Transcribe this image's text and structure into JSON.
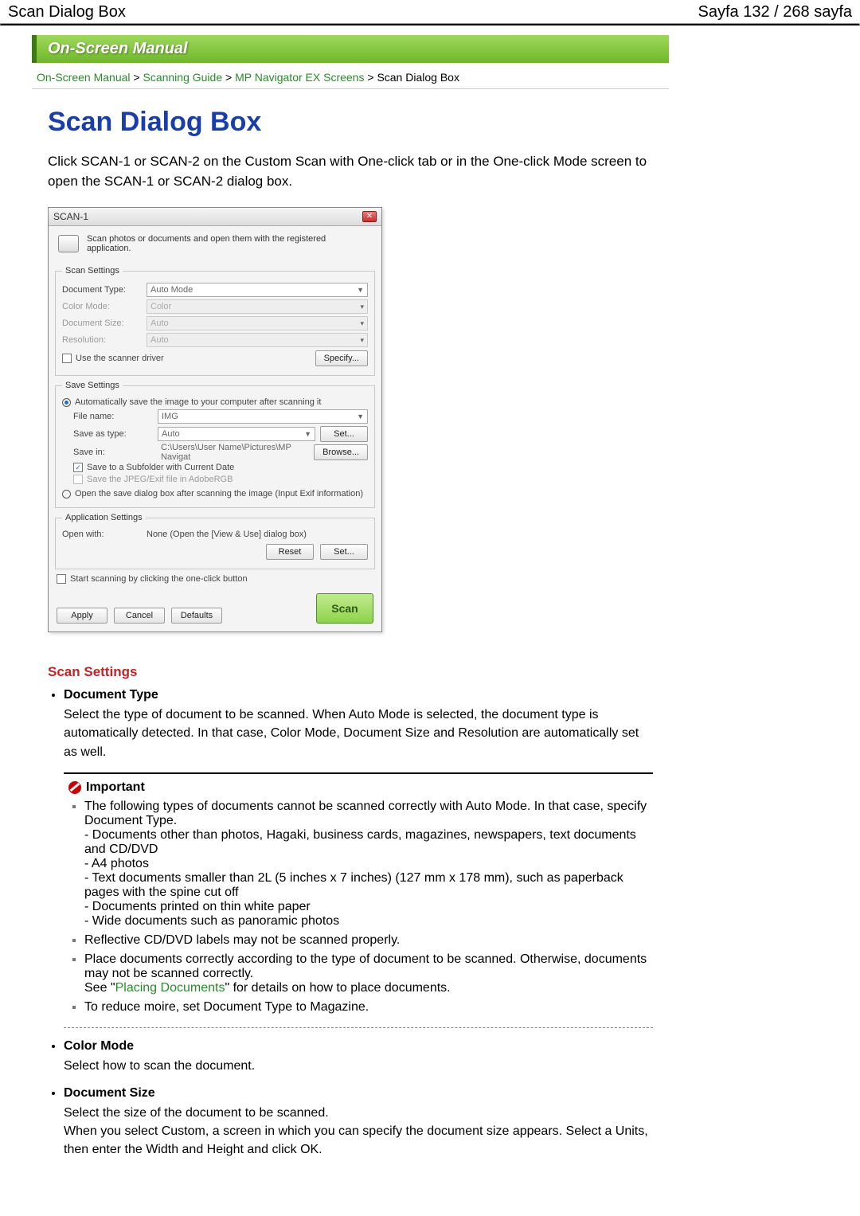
{
  "topbar": {
    "left": "Scan Dialog Box",
    "right": "Sayfa 132 / 268 sayfa"
  },
  "banner": "On-Screen Manual",
  "breadcrumb": {
    "items": [
      "On-Screen Manual",
      "Scanning Guide",
      "MP Navigator EX Screens"
    ],
    "current": "Scan Dialog Box"
  },
  "title": "Scan Dialog Box",
  "intro": "Click SCAN-1 or SCAN-2 on the Custom Scan with One-click tab or in the One-click Mode screen to open the SCAN-1 or SCAN-2 dialog box.",
  "dialog": {
    "title": "SCAN-1",
    "subtitle": "Scan photos or documents and open them with the registered application.",
    "groups": {
      "scan": {
        "legend": "Scan Settings",
        "doc_type": {
          "label": "Document Type:",
          "value": "Auto Mode"
        },
        "color_mode": {
          "label": "Color Mode:",
          "value": "Color"
        },
        "doc_size": {
          "label": "Document Size:",
          "value": "Auto"
        },
        "resolution": {
          "label": "Resolution:",
          "value": "Auto"
        },
        "scanner_driver": "Use the scanner driver",
        "specify_btn": "Specify..."
      },
      "save": {
        "legend": "Save Settings",
        "auto_save_radio": "Automatically save the image to your computer after scanning it",
        "file_name": {
          "label": "File name:",
          "value": "IMG"
        },
        "save_as": {
          "label": "Save as type:",
          "value": "Auto",
          "btn": "Set..."
        },
        "save_in": {
          "label": "Save in:",
          "value": "C:\\Users\\User Name\\Pictures\\MP Navigat",
          "btn": "Browse..."
        },
        "subfolder": "Save to a Subfolder with Current Date",
        "jpeg_exif": "Save the JPEG/Exif file in AdobeRGB",
        "open_save_radio": "Open the save dialog box after scanning the image (Input Exif information)"
      },
      "app": {
        "legend": "Application Settings",
        "open_with": {
          "label": "Open with:",
          "value": "None (Open the [View & Use] dialog box)"
        },
        "reset_btn": "Reset",
        "set_btn": "Set..."
      }
    },
    "start_chk": "Start scanning by clicking the one-click button",
    "buttons": {
      "apply": "Apply",
      "cancel": "Cancel",
      "defaults": "Defaults",
      "scan": "Scan"
    }
  },
  "sections": {
    "scan_settings": {
      "heading": "Scan Settings",
      "items": [
        {
          "title": "Document Type",
          "body": "Select the type of document to be scanned. When Auto Mode is selected, the document type is automatically detected. In that case, Color Mode, Document Size and Resolution are automatically set as well."
        }
      ]
    },
    "important": {
      "label": "Important",
      "bullets": {
        "b1_lead": "The following types of documents cannot be scanned correctly with Auto Mode. In that case, specify Document Type.",
        "b1_dashes": [
          "- Documents other than photos, Hagaki, business cards, magazines, newspapers, text documents and CD/DVD",
          "- A4 photos",
          "- Text documents smaller than 2L (5 inches x 7 inches) (127 mm x 178 mm), such as paperback pages with the spine cut off",
          "- Documents printed on thin white paper",
          "- Wide documents such as panoramic photos"
        ],
        "b2": "Reflective CD/DVD labels may not be scanned properly.",
        "b3a": "Place documents correctly according to the type of document to be scanned. Otherwise, documents may not be scanned correctly.",
        "b3b_pre": "See \"",
        "b3b_link": "Placing Documents",
        "b3b_post": "\" for details on how to place documents.",
        "b4": "To reduce moire, set Document Type to Magazine."
      }
    },
    "color_mode": {
      "title": "Color Mode",
      "body": "Select how to scan the document."
    },
    "document_size": {
      "title": "Document Size",
      "body": "Select the size of the document to be scanned.\nWhen you select Custom, a screen in which you can specify the document size appears. Select a Units, then enter the Width and Height and click OK."
    }
  }
}
